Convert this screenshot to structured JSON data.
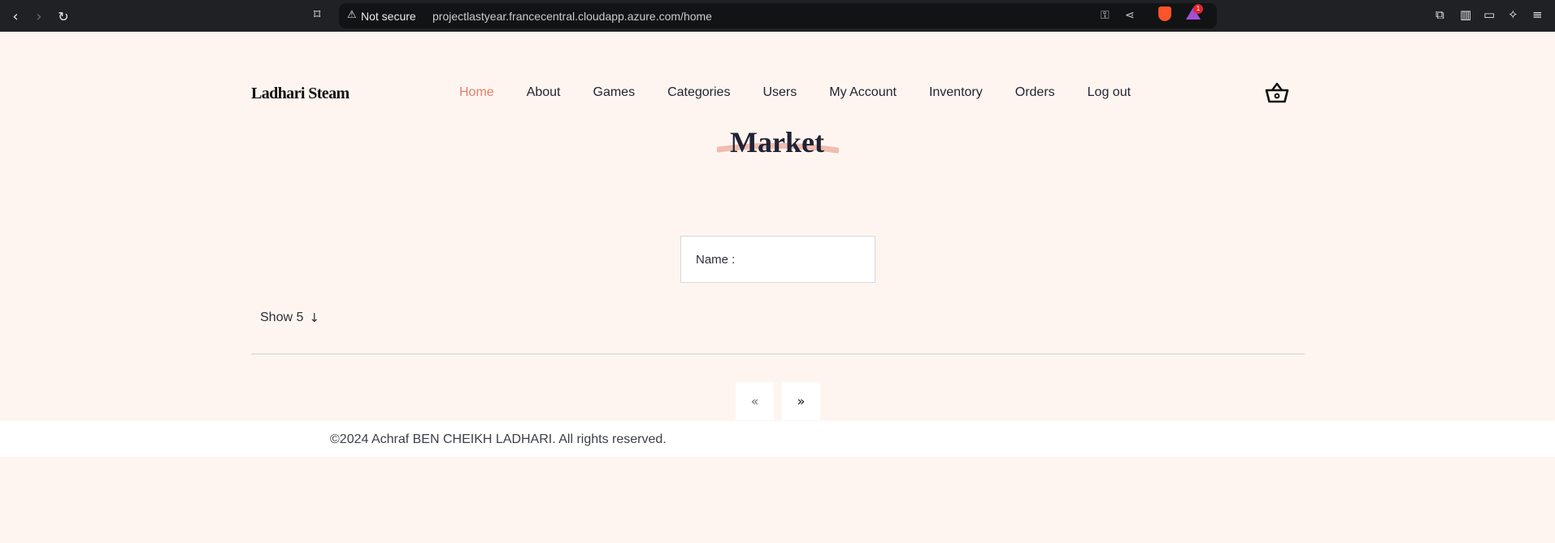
{
  "browser": {
    "security_label": "Not secure",
    "url": "projectlastyear.francecentral.cloudapp.azure.com/home",
    "extension_badge": "1"
  },
  "site": {
    "logo": "Ladhari Steam",
    "nav": [
      "Home",
      "About",
      "Games",
      "Categories",
      "Users",
      "My Account",
      "Inventory",
      "Orders",
      "Log out"
    ],
    "active_nav": "Home"
  },
  "main": {
    "title": "Market",
    "search_label": "Name :",
    "search_value": "",
    "show_label": "Show 5",
    "pager_prev": "«",
    "pager_next": "»"
  },
  "footer": {
    "copyright": "©2024 Achraf BEN CHEIKH LADHARI. All rights reserved."
  },
  "colors": {
    "background": "#fff5f0",
    "accent": "#e0816c",
    "text": "#1f2333"
  }
}
